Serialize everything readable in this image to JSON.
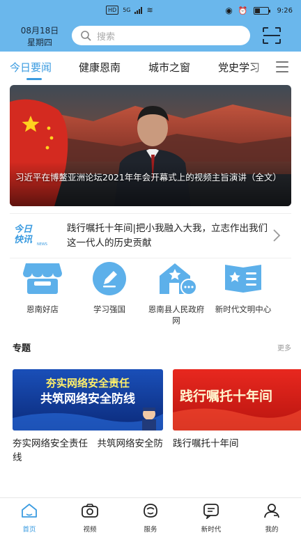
{
  "status_bar": {
    "network_badge": "HD",
    "network_type": "5G",
    "time": "9:26"
  },
  "header": {
    "date": "08月18日",
    "weekday": "星期四",
    "search_placeholder": "搜索"
  },
  "tabs": [
    {
      "label": "今日要闻",
      "active": true
    },
    {
      "label": "健康恩南",
      "active": false
    },
    {
      "label": "城市之窗",
      "active": false
    },
    {
      "label": "党史学习",
      "active": false
    }
  ],
  "banner": {
    "caption": "习近平在博鳌亚洲论坛2021年年会开幕式上的视频主旨演讲（全文）"
  },
  "express": {
    "logo_line1": "今日",
    "logo_line2": "快讯",
    "logo_sub": "NEWS",
    "headline": "践行嘱托十年间|把小我融入大我，立志作出我们这一代人的历史贡献"
  },
  "quick_links": [
    {
      "label": "恩南好店",
      "icon": "shop-icon"
    },
    {
      "label": "学习强国",
      "icon": "pen-icon"
    },
    {
      "label": "恩南县人民政府网",
      "icon": "government-house-icon"
    },
    {
      "label": "新时代文明中心",
      "icon": "star-book-icon"
    }
  ],
  "topics": {
    "title": "专题",
    "more": "更多",
    "cards": [
      {
        "image_line1": "夯实网络安全责任",
        "image_line2": "共筑网络安全防线",
        "title": "夯实网络安全责任　共筑网络安全防线"
      },
      {
        "image_line1": "践行嘱托十年间",
        "title": "践行嘱托十年间"
      }
    ]
  },
  "bottom_nav": [
    {
      "label": "首页",
      "icon": "home-icon",
      "active": true
    },
    {
      "label": "视频",
      "icon": "camera-icon",
      "active": false
    },
    {
      "label": "服务",
      "icon": "service-icon",
      "active": false
    },
    {
      "label": "新时代",
      "icon": "chat-icon",
      "active": false
    },
    {
      "label": "我的",
      "icon": "user-icon",
      "active": false
    }
  ],
  "colors": {
    "header_blue": "#6ab7ec",
    "accent_blue": "#3a9be0",
    "red_banner": "#d0201c"
  }
}
